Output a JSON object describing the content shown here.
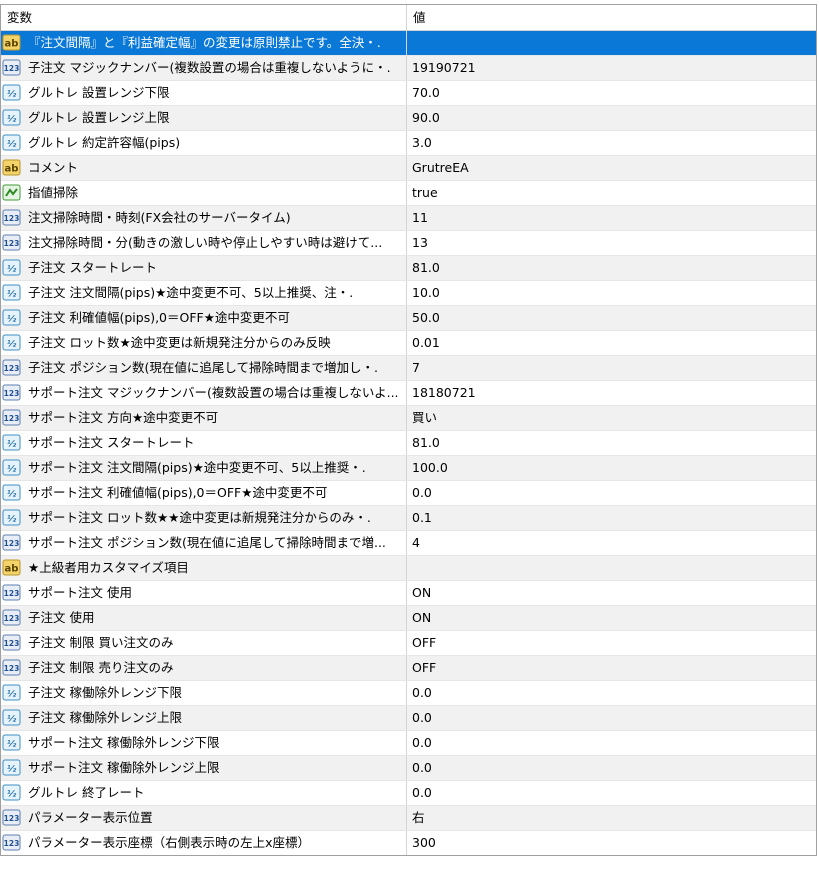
{
  "header": {
    "name": "変数",
    "value": "値"
  },
  "rows": [
    {
      "icon": "string-ab-icon",
      "name": "『注文間隔』と『利益確定幅』の変更は原則禁止です。全決・.",
      "value": "",
      "selected": true
    },
    {
      "icon": "integer-123-icon",
      "name": "子注文 マジックナンバー(複数設置の場合は重複しないように・.",
      "value": "19190721"
    },
    {
      "icon": "double-v2-icon",
      "name": "グルトレ 設置レンジ下限",
      "value": "70.0"
    },
    {
      "icon": "double-v2-icon",
      "name": "グルトレ 設置レンジ上限",
      "value": "90.0"
    },
    {
      "icon": "double-v2-icon",
      "name": "グルトレ 約定許容幅(pips)",
      "value": "3.0"
    },
    {
      "icon": "string-ab-icon",
      "name": "コメント",
      "value": "GrutreEA"
    },
    {
      "icon": "bool-toggle-icon",
      "name": "指値掃除",
      "value": "true"
    },
    {
      "icon": "integer-123-icon",
      "name": "注文掃除時間・時刻(FX会社のサーバータイム)",
      "value": "11"
    },
    {
      "icon": "integer-123-icon",
      "name": "注文掃除時間・分(動きの激しい時や停止しやすい時は避けて...",
      "value": "13"
    },
    {
      "icon": "double-v2-icon",
      "name": "子注文 スタートレート",
      "value": "81.0"
    },
    {
      "icon": "double-v2-icon",
      "name": "子注文 注文間隔(pips)★途中変更不可、5以上推奨、注・.",
      "value": "10.0"
    },
    {
      "icon": "double-v2-icon",
      "name": "子注文 利確値幅(pips),0＝OFF★途中変更不可",
      "value": "50.0"
    },
    {
      "icon": "double-v2-icon",
      "name": "子注文 ロット数★途中変更は新規発注分からのみ反映",
      "value": "0.01"
    },
    {
      "icon": "integer-123-icon",
      "name": "子注文 ポジション数(現在値に追尾して掃除時間まで増加し・.",
      "value": "7"
    },
    {
      "icon": "integer-123-icon",
      "name": "サポート注文 マジックナンバー(複数設置の場合は重複しないよ...",
      "value": "18180721"
    },
    {
      "icon": "integer-123-icon",
      "name": "サポート注文 方向★途中変更不可",
      "value": "買い"
    },
    {
      "icon": "double-v2-icon",
      "name": "サポート注文 スタートレート",
      "value": "81.0"
    },
    {
      "icon": "double-v2-icon",
      "name": "サポート注文 注文間隔(pips)★途中変更不可、5以上推奨・.",
      "value": "100.0"
    },
    {
      "icon": "double-v2-icon",
      "name": "サポート注文 利確値幅(pips),0＝OFF★途中変更不可",
      "value": "0.0"
    },
    {
      "icon": "double-v2-icon",
      "name": "サポート注文 ロット数★★途中変更は新規発注分からのみ・.",
      "value": "0.1"
    },
    {
      "icon": "integer-123-icon",
      "name": "サポート注文 ポジション数(現在値に追尾して掃除時間まで増...",
      "value": "4"
    },
    {
      "icon": "string-ab-icon",
      "name": "★上級者用カスタマイズ項目",
      "value": ""
    },
    {
      "icon": "integer-123-icon",
      "name": "サポート注文 使用",
      "value": "ON"
    },
    {
      "icon": "integer-123-icon",
      "name": "子注文 使用",
      "value": "ON"
    },
    {
      "icon": "integer-123-icon",
      "name": "子注文 制限 買い注文のみ",
      "value": "OFF"
    },
    {
      "icon": "integer-123-icon",
      "name": "子注文 制限 売り注文のみ",
      "value": "OFF"
    },
    {
      "icon": "double-v2-icon",
      "name": "子注文 稼働除外レンジ下限",
      "value": "0.0"
    },
    {
      "icon": "double-v2-icon",
      "name": "子注文 稼働除外レンジ上限",
      "value": "0.0"
    },
    {
      "icon": "double-v2-icon",
      "name": "サポート注文 稼働除外レンジ下限",
      "value": "0.0"
    },
    {
      "icon": "double-v2-icon",
      "name": "サポート注文 稼働除外レンジ上限",
      "value": "0.0"
    },
    {
      "icon": "double-v2-icon",
      "name": "グルトレ 終了レート",
      "value": "0.0"
    },
    {
      "icon": "integer-123-icon",
      "name": "パラメーター表示位置",
      "value": "右"
    },
    {
      "icon": "integer-123-icon",
      "name": "パラメーター表示座標（右側表示時の左上x座標）",
      "value": "300"
    }
  ],
  "colors": {
    "selected": "#0a78d7",
    "alt_row": "#f1f1f1",
    "grid_line": "#d4d4d4"
  }
}
